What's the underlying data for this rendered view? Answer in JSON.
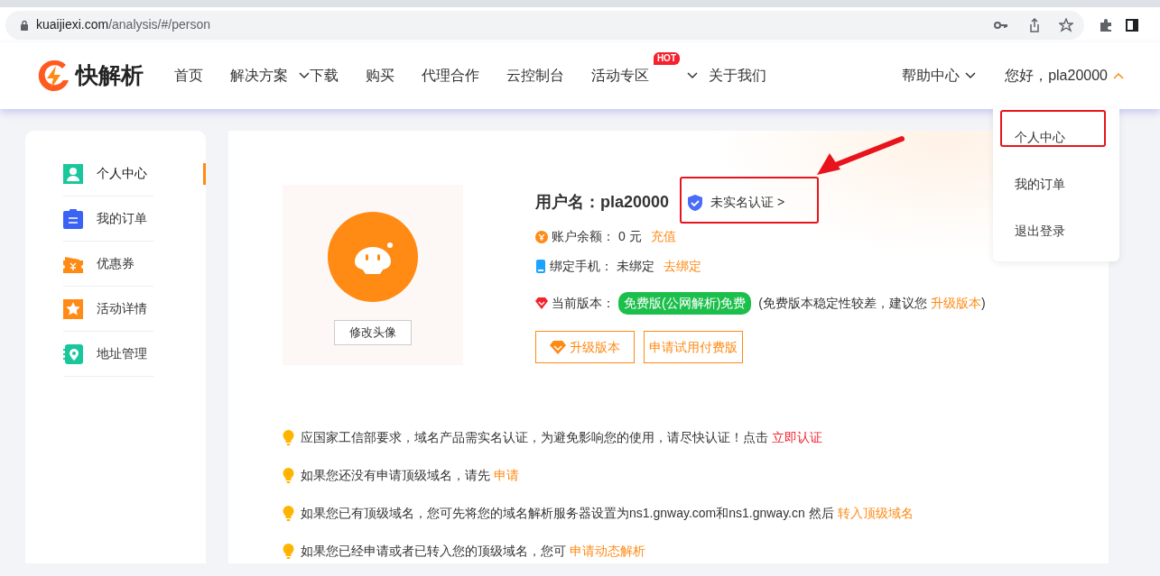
{
  "browser": {
    "url_host": "kuaijiexi.com",
    "url_path": "/analysis/#/person"
  },
  "header": {
    "logo_text": "快解析",
    "nav": [
      {
        "label": "首页",
        "has_menu": false
      },
      {
        "label": "解决方案",
        "has_menu": true
      },
      {
        "label": "下载",
        "has_menu": false
      },
      {
        "label": "购买",
        "has_menu": false
      },
      {
        "label": "代理合作",
        "has_menu": false
      },
      {
        "label": "云控制台",
        "has_menu": false
      },
      {
        "label": "活动专区",
        "has_menu": true,
        "badge": "HOT"
      },
      {
        "label": "关于我们",
        "has_menu": false
      }
    ],
    "help": {
      "label": "帮助中心",
      "expanded": false
    },
    "user": {
      "label": "您好，pla20000",
      "expanded": true
    }
  },
  "user_menu": [
    {
      "label": "个人中心",
      "annotated": true
    },
    {
      "label": "我的订单",
      "annotated": false
    },
    {
      "label": "退出登录",
      "annotated": false
    }
  ],
  "sidebar": [
    {
      "label": "个人中心",
      "selected": true
    },
    {
      "label": "我的订单",
      "selected": false
    },
    {
      "label": "优惠券",
      "selected": false
    },
    {
      "label": "活动详情",
      "selected": false
    },
    {
      "label": "地址管理",
      "selected": false
    }
  ],
  "profile": {
    "avatar_button": "修改头像",
    "username": "用户名：pla20000",
    "verify": {
      "label": "未实名认证 >",
      "annotated": true
    },
    "balance": {
      "label": "账户余额：",
      "value": "0 元",
      "link": "充值"
    },
    "phone": {
      "label": "绑定手机：",
      "value": "未绑定",
      "link": "去绑定"
    },
    "version": {
      "label": "当前版本：",
      "badge": "免费版(公网解析)免费",
      "note_before": "(免费版本稳定性较差，建议您 ",
      "note_link": "升级版本",
      "note_after": ")"
    },
    "buttons": [
      {
        "label": "升级版本",
        "kind": "icon"
      },
      {
        "label": "申请试用付费版",
        "kind": "plain"
      }
    ]
  },
  "tips": [
    {
      "text": "应国家工信部要求，域名产品需实名认证，为避免影响您的使用，请尽快认证！点击 ",
      "link": "立即认证",
      "kind": "urgent"
    },
    {
      "text": "如果您还没有申请顶级域名，请先 ",
      "link": "申请",
      "kind": "normal"
    },
    {
      "text": "如果您已有顶级域名，您可先将您的域名解析服务器设置为ns1.gnway.com和ns1.gnway.cn 然后 ",
      "link": "转入顶级域名",
      "kind": "normal"
    },
    {
      "text": "如果您已经申请或者已转入您的顶级域名，您可 ",
      "link": "申请动态解析",
      "kind": "normal"
    }
  ]
}
